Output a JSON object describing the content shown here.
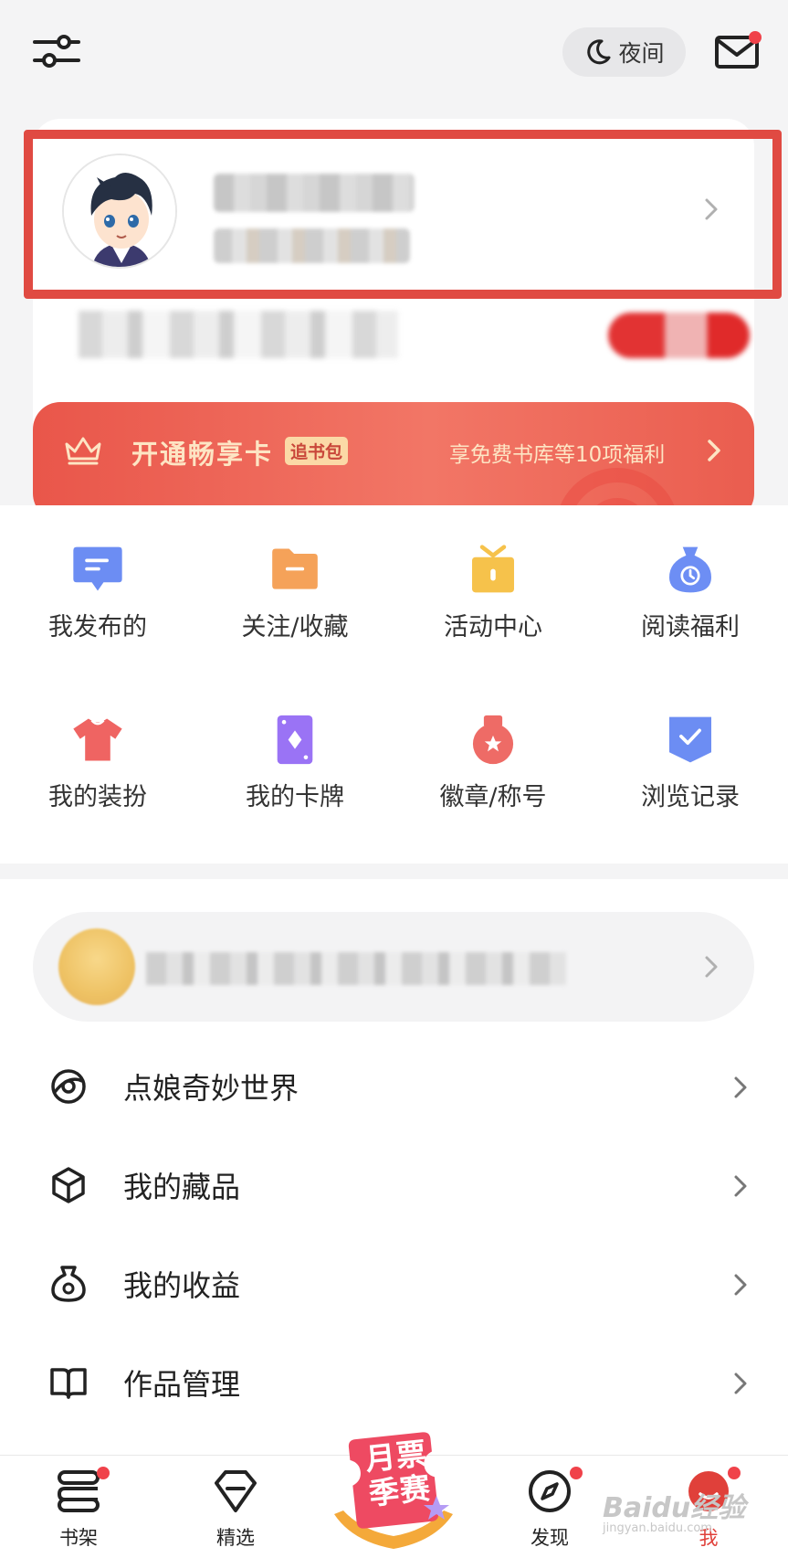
{
  "topbar": {
    "night_label": "夜间",
    "settings_icon": "sliders-icon",
    "mail_icon": "mail-icon",
    "mail_has_badge": true
  },
  "profile": {
    "avatar_icon": "cartoon-boy-avatar"
  },
  "vip": {
    "title": "开通畅享卡",
    "tag": "追书包",
    "desc": "享免费书库等10项福利"
  },
  "grid": [
    {
      "label": "我发布的",
      "icon": "message-icon",
      "color": "#6c8df3"
    },
    {
      "label": "关注/收藏",
      "icon": "folder-icon",
      "color": "#f5a259"
    },
    {
      "label": "活动中心",
      "icon": "gift-icon",
      "color": "#f6c24b"
    },
    {
      "label": "阅读福利",
      "icon": "money-bag-icon",
      "color": "#6d8ef4"
    },
    {
      "label": "我的装扮",
      "icon": "tshirt-icon",
      "color": "#ef6462"
    },
    {
      "label": "我的卡牌",
      "icon": "card-icon",
      "color": "#9a73f5"
    },
    {
      "label": "徽章/称号",
      "icon": "medal-icon",
      "color": "#ee6b66"
    },
    {
      "label": "浏览记录",
      "icon": "history-icon",
      "color": "#6c8df3"
    }
  ],
  "list": [
    {
      "label": "点娘奇妙世界",
      "icon": "world-icon"
    },
    {
      "label": "我的藏品",
      "icon": "cube-icon"
    },
    {
      "label": "我的收益",
      "icon": "earnings-icon"
    },
    {
      "label": "作品管理",
      "icon": "book-icon"
    }
  ],
  "nav": {
    "shelf": "书架",
    "featured": "精选",
    "promo_line1": "月票",
    "promo_line2": "季赛",
    "discover": "发现",
    "me": "我",
    "watermark": "Baidu经验",
    "watermark_sub": "jingyan.baidu.com",
    "accent": "#e0403a"
  }
}
